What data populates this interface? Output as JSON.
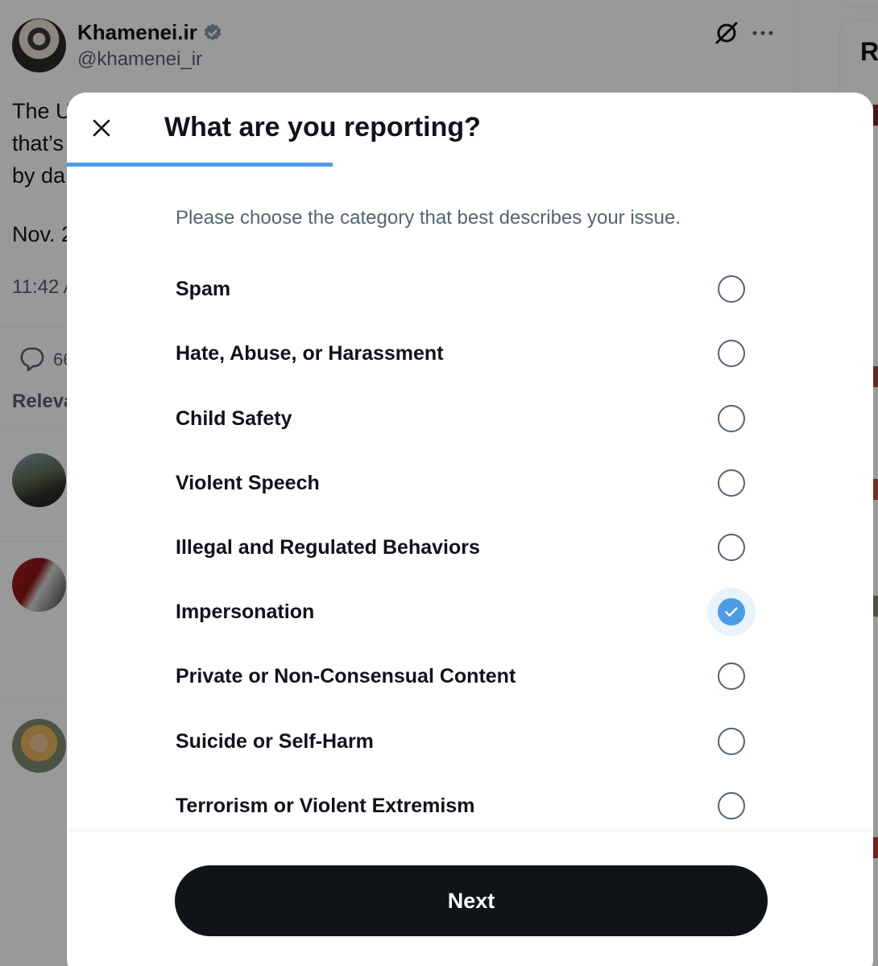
{
  "tweet": {
    "author_name": "Khamenei.ir",
    "author_handle": "@khamenei_ir",
    "text_lines": [
      "The U",
      "that’s",
      "by da"
    ],
    "date": "Nov. 2",
    "time": "11:42 A",
    "reply_count": "66",
    "relevant_label": "Releva"
  },
  "right_panel": {
    "heading": "R"
  },
  "modal": {
    "close_icon": "close-icon",
    "title": "What are you reporting?",
    "progress_fraction": 0.33,
    "subtitle": "Please choose the category that best describes your issue.",
    "options": [
      {
        "label": "Spam",
        "selected": false
      },
      {
        "label": "Hate, Abuse, or Harassment",
        "selected": false
      },
      {
        "label": "Child Safety",
        "selected": false
      },
      {
        "label": "Violent Speech",
        "selected": false
      },
      {
        "label": "Illegal and Regulated Behaviors",
        "selected": false
      },
      {
        "label": "Impersonation",
        "selected": true
      },
      {
        "label": "Private or Non-Consensual Content",
        "selected": false
      },
      {
        "label": "Suicide or Self-Harm",
        "selected": false
      },
      {
        "label": "Terrorism or Violent Extremism",
        "selected": false
      }
    ],
    "next_label": "Next"
  },
  "colors": {
    "accent": "#4c9be8",
    "button_bg": "#0f1419",
    "text_primary": "#0f1419",
    "text_secondary": "#536471"
  }
}
